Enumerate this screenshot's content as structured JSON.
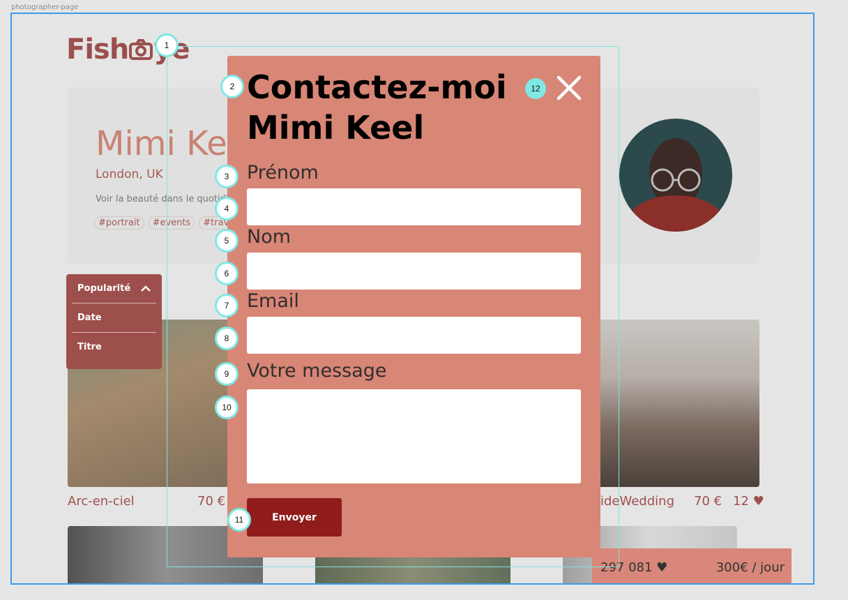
{
  "frame_label": "photographer-page",
  "logo": {
    "part1": "Fish",
    "part2": "ye"
  },
  "photographer": {
    "name": "Mimi Keel",
    "location": "London, UK",
    "tagline": "Voir la beauté dans le quotidien",
    "tags": [
      "#portrait",
      "#events",
      "#travel"
    ]
  },
  "sort_menu": {
    "items": [
      "Popularité",
      "Date",
      "Titre"
    ]
  },
  "gallery": [
    {
      "title": "Arc-en-ciel",
      "price": "70 €"
    },
    {
      "title": "SeasideWedding",
      "price": "70 €",
      "likes": "12"
    }
  ],
  "price_box": {
    "likes": "297 081",
    "rate": "300€ / jour"
  },
  "modal": {
    "title": "Contactez-moi Mimi Keel",
    "title_line1": "Contactez-moi",
    "title_line2": "Mimi Keel",
    "fields": {
      "firstname": {
        "label": "Prénom",
        "value": ""
      },
      "lastname": {
        "label": "Nom",
        "value": ""
      },
      "email": {
        "label": "Email",
        "value": ""
      },
      "message": {
        "label": "Votre message",
        "value": ""
      }
    },
    "submit_label": "Envoyer"
  },
  "markers": [
    "1",
    "2",
    "3",
    "4",
    "5",
    "6",
    "7",
    "8",
    "9",
    "10",
    "11",
    "12"
  ],
  "colors": {
    "modal_bg": "#d88676",
    "submit": "#901c1c",
    "brand": "#9b4f4d",
    "marker": "#7fe8e3",
    "frame": "#3d9be9"
  }
}
